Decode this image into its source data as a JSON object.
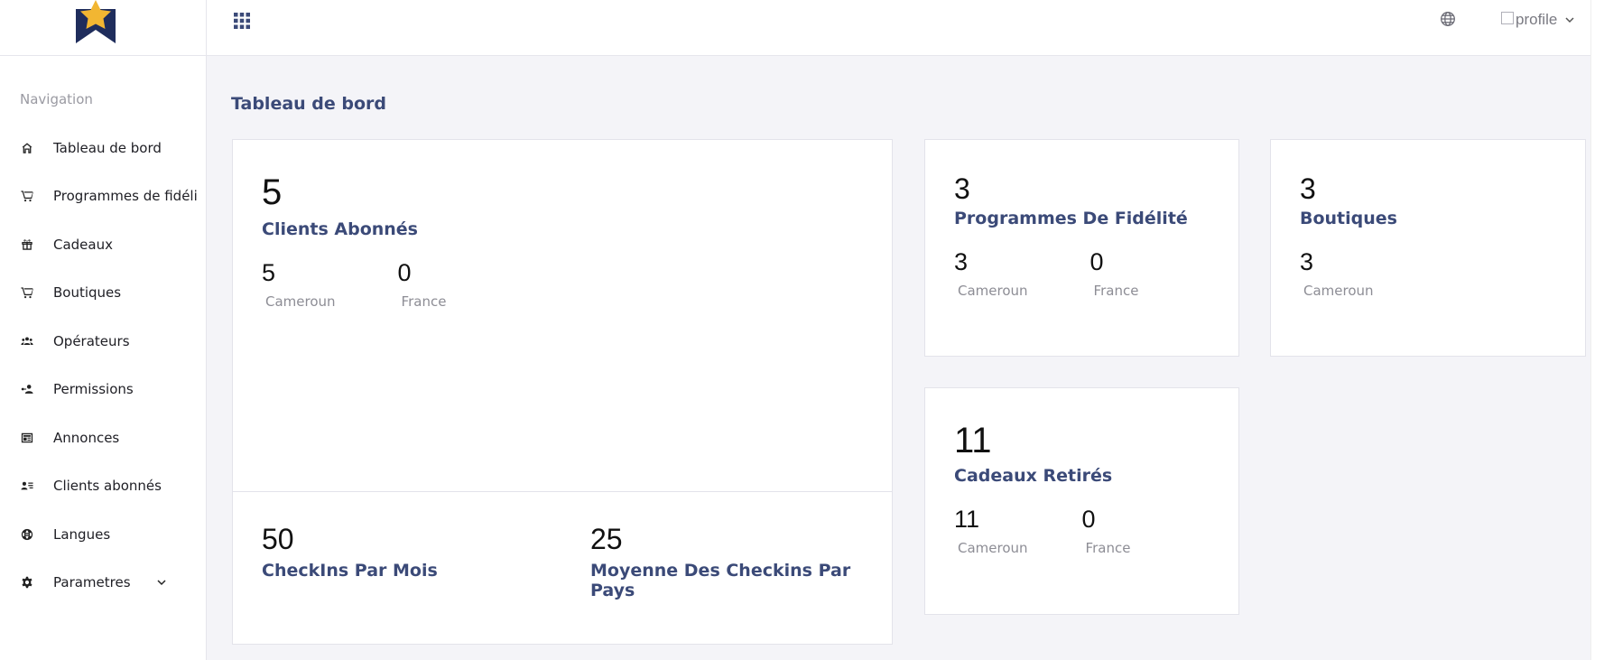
{
  "sidebar": {
    "heading": "Navigation",
    "items": [
      {
        "label": "Tableau de bord",
        "icon": "home-icon"
      },
      {
        "label": "Programmes de fidélité",
        "icon": "cart-icon"
      },
      {
        "label": "Cadeaux",
        "icon": "gift-icon"
      },
      {
        "label": "Boutiques",
        "icon": "cart-icon"
      },
      {
        "label": "Opérateurs",
        "icon": "group-icon"
      },
      {
        "label": "Permissions",
        "icon": "person-key-icon"
      },
      {
        "label": "Annonces",
        "icon": "newspaper-icon"
      },
      {
        "label": "Clients abonnés",
        "icon": "person-list-icon"
      },
      {
        "label": "Langues",
        "icon": "globe-icon"
      },
      {
        "label": "Parametres",
        "icon": "gear-icon"
      }
    ]
  },
  "topbar": {
    "profile_alt": "profile"
  },
  "page": {
    "title": "Tableau de bord"
  },
  "cards": {
    "clients": {
      "value": "5",
      "title": "Clients Abonnés",
      "breakdown": [
        {
          "value": "5",
          "label": "Cameroun"
        },
        {
          "value": "0",
          "label": "France"
        }
      ]
    },
    "checkins": {
      "value": "50",
      "title": "CheckIns Par Mois"
    },
    "average": {
      "value": "25",
      "title": "Moyenne Des Checkins Par Pays"
    },
    "programmes": {
      "value": "3",
      "title": "Programmes De Fidélité",
      "breakdown": [
        {
          "value": "3",
          "label": "Cameroun"
        },
        {
          "value": "0",
          "label": "France"
        }
      ]
    },
    "boutiques": {
      "value": "3",
      "title": "Boutiques",
      "breakdown": [
        {
          "value": "3",
          "label": "Cameroun"
        }
      ]
    },
    "cadeaux": {
      "value": "11",
      "title": "Cadeaux Retirés",
      "breakdown": [
        {
          "value": "11",
          "label": "Cameroun"
        },
        {
          "value": "0",
          "label": "France"
        }
      ]
    }
  },
  "colors": {
    "accent": "#3b4a78",
    "logo_navy": "#1f2d5c",
    "logo_gold": "#f2b632"
  }
}
